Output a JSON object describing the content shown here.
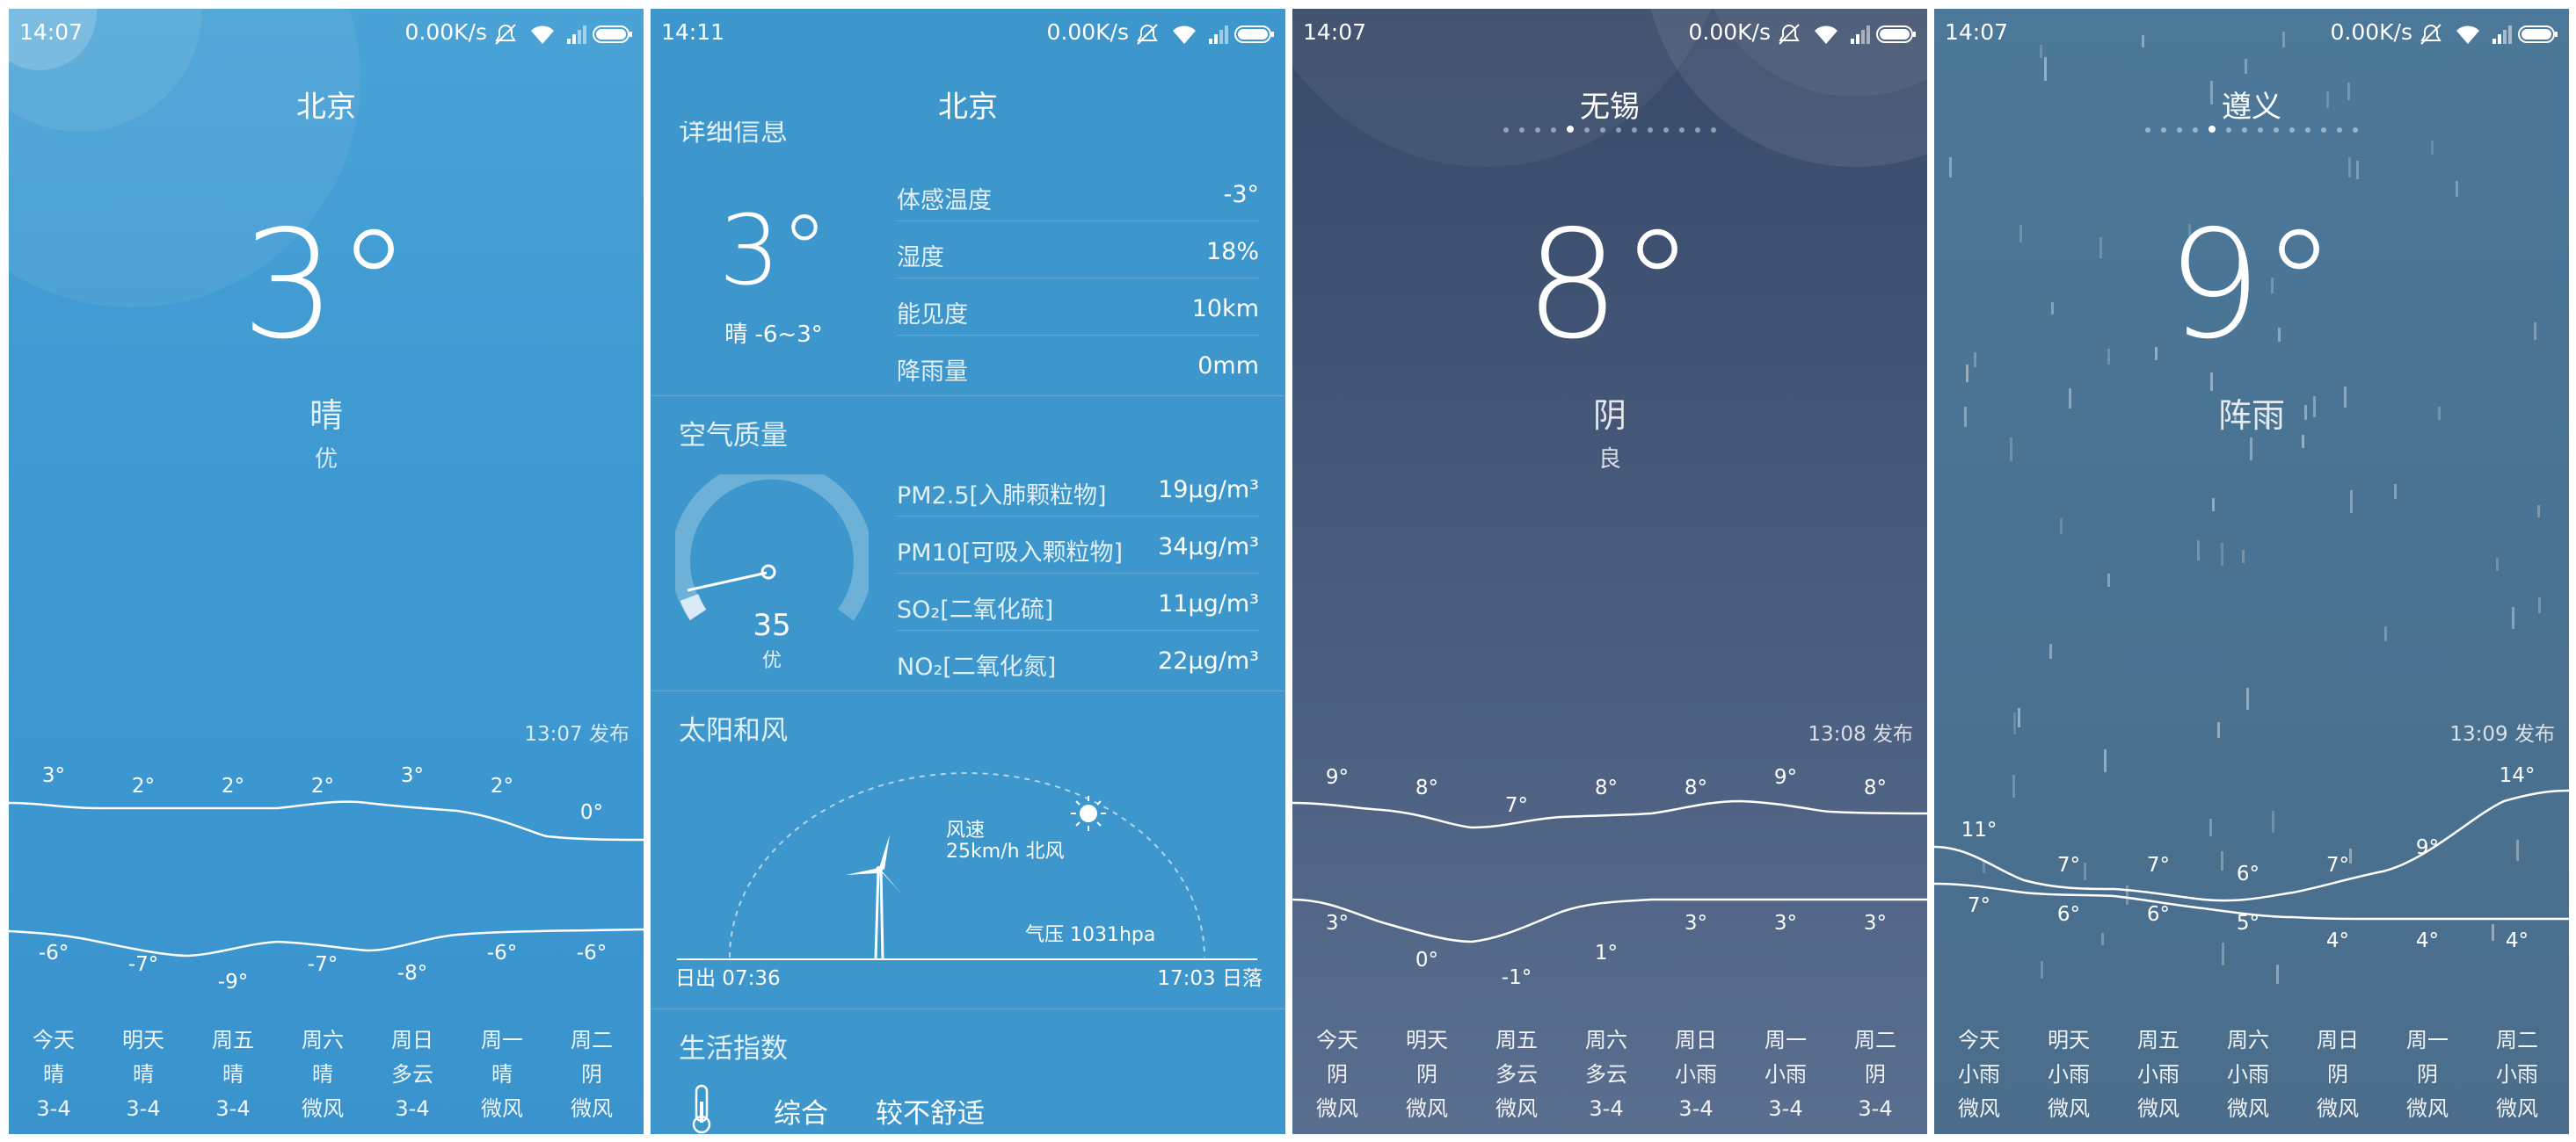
{
  "panel1": {
    "status": {
      "time": "14:07",
      "speed": "0.00K/s"
    },
    "city": "北京",
    "temp": "3°",
    "condition": "晴",
    "aqi": "优",
    "published": "13:07 发布",
    "highs": [
      "3°",
      "2°",
      "2°",
      "2°",
      "3°",
      "2°",
      "0°"
    ],
    "lows": [
      "-6°",
      "-7°",
      "-9°",
      "-7°",
      "-8°",
      "-6°",
      "-6°"
    ],
    "days": [
      {
        "name": "今天",
        "cond": "晴",
        "wind": "3-4"
      },
      {
        "name": "明天",
        "cond": "晴",
        "wind": "3-4"
      },
      {
        "name": "周五",
        "cond": "晴",
        "wind": "3-4"
      },
      {
        "name": "周六",
        "cond": "晴",
        "wind": "微风"
      },
      {
        "name": "周日",
        "cond": "多云",
        "wind": "3-4"
      },
      {
        "name": "周一",
        "cond": "晴",
        "wind": "微风"
      },
      {
        "name": "周二",
        "cond": "阴",
        "wind": "微风"
      }
    ]
  },
  "panel2": {
    "status": {
      "time": "14:11",
      "speed": "0.00K/s"
    },
    "city": "北京",
    "section_detail": "详细信息",
    "temp": "3°",
    "temp_sub": "晴 -6~3°",
    "details": [
      {
        "k": "体感温度",
        "v": "-3°"
      },
      {
        "k": "湿度",
        "v": "18%"
      },
      {
        "k": "能见度",
        "v": "10km"
      },
      {
        "k": "降雨量",
        "v": "0mm"
      }
    ],
    "section_air": "空气质量",
    "aqi_value": "35",
    "aqi_label": "优",
    "aqi_fraction": 0.12,
    "pollutants": [
      {
        "k": "PM2.5[入肺颗粒物]",
        "v": "19μg/m³"
      },
      {
        "k": "PM10[可吸入颗粒物]",
        "v": "34μg/m³"
      },
      {
        "k": "SO₂[二氧化硫]",
        "v": "11μg/m³"
      },
      {
        "k": "NO₂[二氧化氮]",
        "v": "22μg/m³"
      }
    ],
    "section_sun": "太阳和风",
    "wind_label": "风速",
    "wind_value": "25km/h 北风",
    "pressure": "气压 1031hpa",
    "sunrise": "日出 07:36",
    "sunset": "17:03 日落",
    "section_life": "生活指数",
    "life_item": "综合",
    "life_value": "较不舒适"
  },
  "panel3": {
    "status": {
      "time": "14:07",
      "speed": "0.00K/s"
    },
    "city": "无锡",
    "temp": "8°",
    "condition": "阴",
    "aqi": "良",
    "published": "13:08 发布",
    "highs": [
      "9°",
      "8°",
      "7°",
      "8°",
      "8°",
      "9°",
      "8°"
    ],
    "lows": [
      "3°",
      "0°",
      "-1°",
      "1°",
      "3°",
      "3°",
      "3°"
    ],
    "days": [
      {
        "name": "今天",
        "cond": "阴",
        "wind": "微风"
      },
      {
        "name": "明天",
        "cond": "阴",
        "wind": "微风"
      },
      {
        "name": "周五",
        "cond": "多云",
        "wind": "微风"
      },
      {
        "name": "周六",
        "cond": "多云",
        "wind": "3-4"
      },
      {
        "name": "周日",
        "cond": "小雨",
        "wind": "3-4"
      },
      {
        "name": "周一",
        "cond": "小雨",
        "wind": "3-4"
      },
      {
        "name": "周二",
        "cond": "阴",
        "wind": "3-4"
      }
    ]
  },
  "panel4": {
    "status": {
      "time": "14:07",
      "speed": "0.00K/s"
    },
    "city": "遵义",
    "temp": "9°",
    "condition": "阵雨",
    "published": "13:09 发布",
    "highs": [
      "11°",
      "7°",
      "7°",
      "6°",
      "7°",
      "9°",
      "14°"
    ],
    "lows": [
      "7°",
      "6°",
      "6°",
      "5°",
      "4°",
      "4°",
      "4°"
    ],
    "days": [
      {
        "name": "今天",
        "cond": "小雨",
        "wind": "微风"
      },
      {
        "name": "明天",
        "cond": "小雨",
        "wind": "微风"
      },
      {
        "name": "周五",
        "cond": "小雨",
        "wind": "微风"
      },
      {
        "name": "周六",
        "cond": "小雨",
        "wind": "微风"
      },
      {
        "name": "周日",
        "cond": "阴",
        "wind": "微风"
      },
      {
        "name": "周一",
        "cond": "阴",
        "wind": "微风"
      },
      {
        "name": "周二",
        "cond": "小雨",
        "wind": "微风"
      }
    ]
  },
  "colors": {
    "clear": "#3f9ad2",
    "cloudy": "#46597a",
    "rain": "#4a7292"
  },
  "icons": [
    "mute-icon",
    "wifi-icon",
    "signal-icon",
    "battery-icon",
    "thermometer-icon",
    "sun-icon",
    "wind-turbine-icon",
    "aqi-gauge-icon"
  ]
}
